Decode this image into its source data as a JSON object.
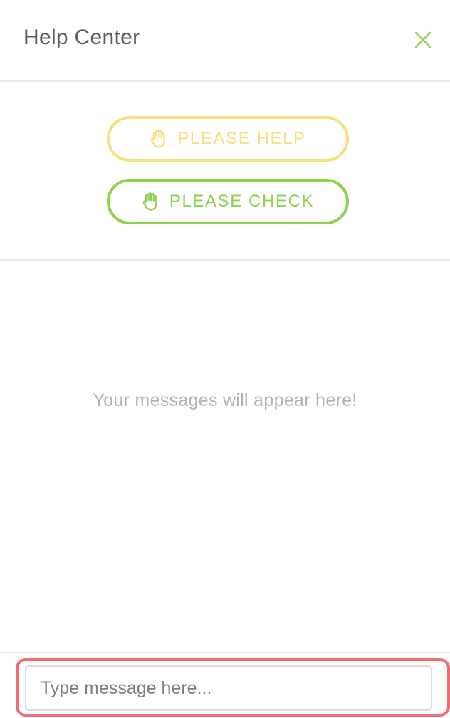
{
  "header": {
    "title": "Help Center",
    "close_icon": "close-icon"
  },
  "actions": {
    "help_label": "PLEASE HELP",
    "check_label": "PLEASE CHECK",
    "help_color": "#f6df7e",
    "check_color": "#8fd14f",
    "icon": "raised-hand-icon"
  },
  "messages": {
    "empty_text": "Your messages will appear here!"
  },
  "composer": {
    "value": "",
    "placeholder": "Type message here..."
  },
  "colors": {
    "accent": "#8fd14f",
    "highlight": "#f26d72",
    "divider": "#e9e9e9"
  }
}
